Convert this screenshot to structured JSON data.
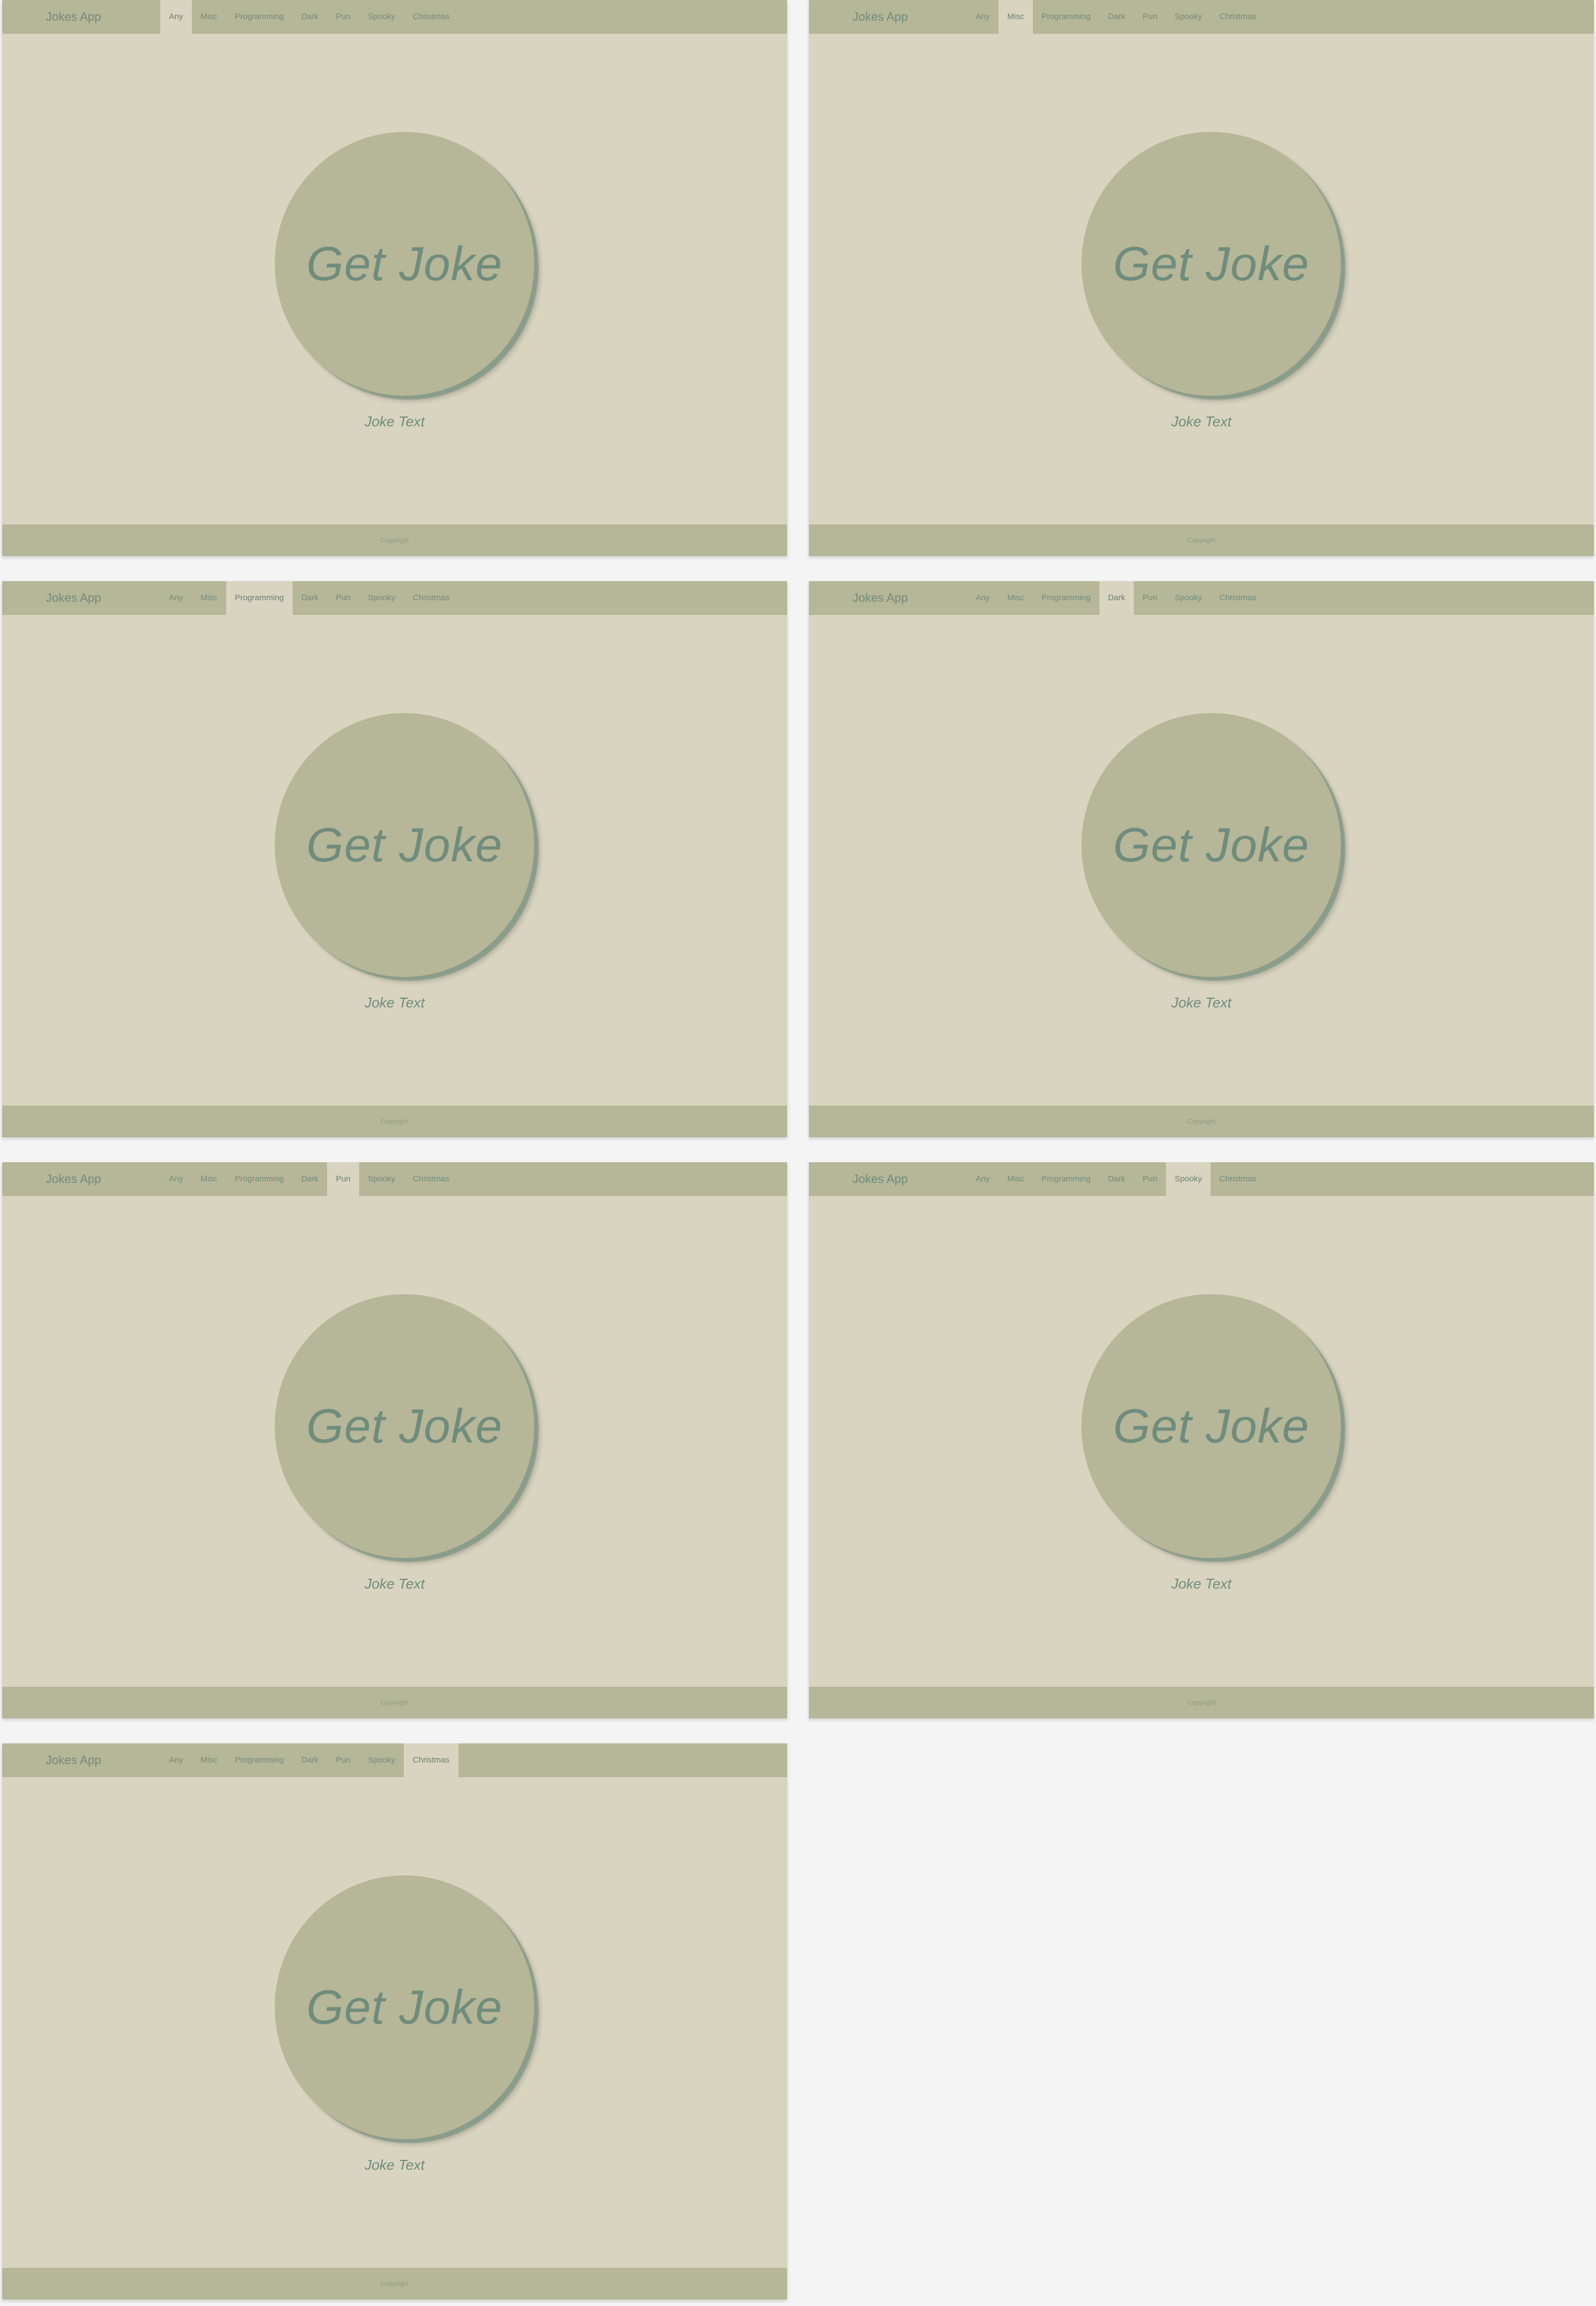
{
  "app": {
    "brand": "Jokes App",
    "button_label": "Get Joke",
    "joke_text": "Joke Text",
    "footer_text": "Copyright"
  },
  "categories": [
    "Any",
    "Misc",
    "Programming",
    "Dark",
    "Pun",
    "Spooky",
    "Christmas"
  ],
  "frames": [
    {
      "state": "Any"
    },
    {
      "state": "Misc"
    },
    {
      "state": "Programming"
    },
    {
      "state": "Dark"
    },
    {
      "state": "Pun"
    },
    {
      "state": "Spooky"
    },
    {
      "state": "Christmas"
    }
  ],
  "colors": {
    "page_background": "#f4f4f4",
    "frame_background": "#d9d4bf",
    "nav_background": "#b6b698",
    "text_primary": "#6f8c7c"
  }
}
